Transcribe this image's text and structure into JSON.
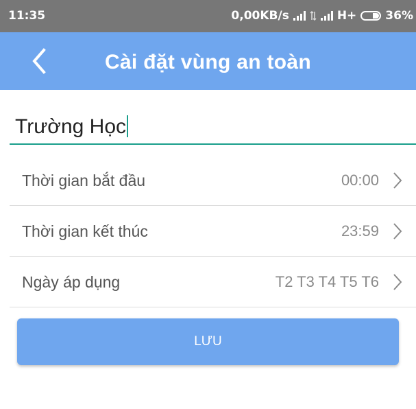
{
  "status_bar": {
    "time": "11:35",
    "network_speed": "0,00KB/s",
    "network_type": "H+",
    "battery": "36%"
  },
  "app_bar": {
    "back_icon": "chevron-left-icon",
    "title": "Cài đặt vùng an toàn"
  },
  "name_field": {
    "value": "Trường Học"
  },
  "settings": [
    {
      "label": "Thời gian bắt đầu",
      "value": "00:00",
      "icon": "chevron-right-icon"
    },
    {
      "label": "Thời gian kết thúc",
      "value": "23:59",
      "icon": "chevron-right-icon"
    },
    {
      "label": "Ngày áp dụng",
      "value": "T2 T3 T4 T5 T6",
      "icon": "chevron-right-icon"
    }
  ],
  "save_button": {
    "label": "LƯU"
  },
  "colors": {
    "primary": "#6fa6ee",
    "accent": "#1a9e8b",
    "status_bar": "#777777"
  }
}
